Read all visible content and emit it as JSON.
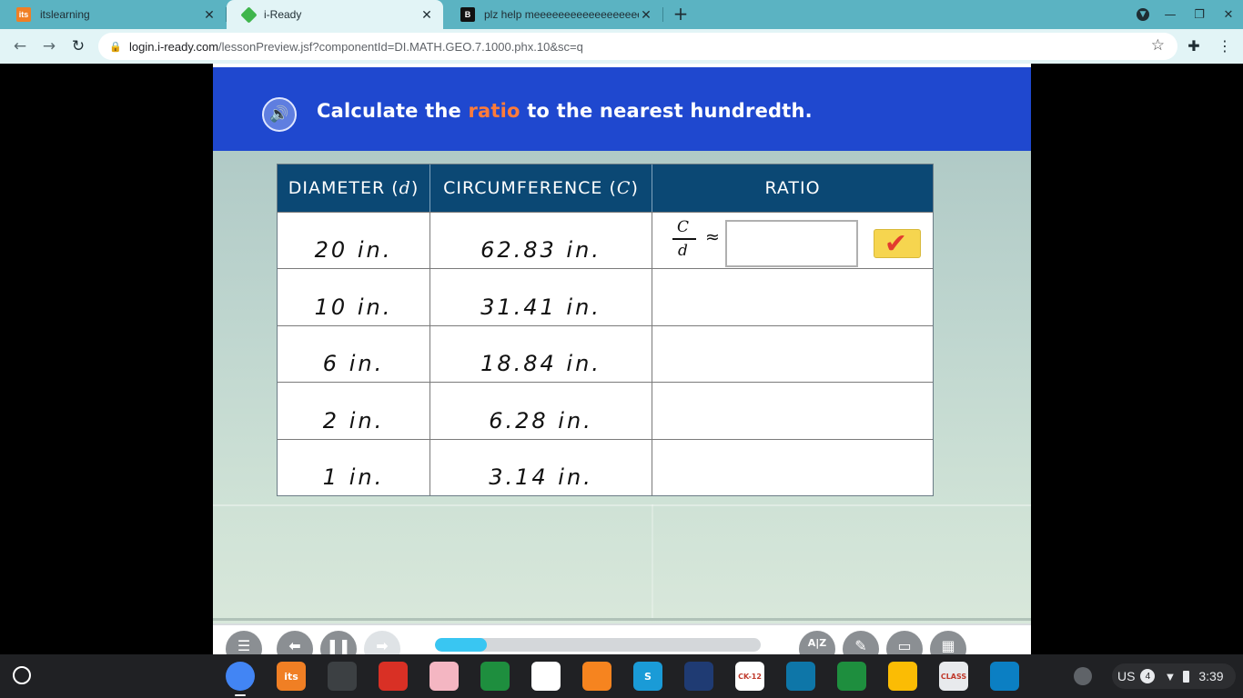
{
  "browser": {
    "tabs": [
      {
        "title": "itslearning",
        "favicon": "its",
        "favicon_color": "#f07f24",
        "active": false
      },
      {
        "title": "i-Ready",
        "favicon": "iready-cube-icon",
        "favicon_color": "#3fb54c",
        "active": true
      },
      {
        "title": "plz help meeeeeeeeeeeeeeeeeeeeeeeee",
        "favicon": "B",
        "favicon_color": "#111111",
        "active": false
      }
    ],
    "new_tab_label": "+",
    "address": {
      "domain": "login.i-ready.com",
      "path": "/lessonPreview.jsf?componentId=DI.MATH.GEO.7.1000.phx.10&sc=q"
    }
  },
  "lesson": {
    "prompt_before": "Calculate the ",
    "prompt_highlight": "ratio",
    "prompt_after": " to the nearest hundredth.",
    "highlight_color": "#ff7b39",
    "header_color": "#1f48cf",
    "table": {
      "headers": {
        "diameter": "DIAMETER (",
        "diameter_var": "d",
        "circumference": "CIRCUMFERENCE (",
        "circumference_var": "C",
        "close": ")",
        "ratio": "RATIO"
      },
      "rows": [
        {
          "diameter": "20 in.",
          "circumference": "62.83 in."
        },
        {
          "diameter": "10 in.",
          "circumference": "31.41 in."
        },
        {
          "diameter": "6 in.",
          "circumference": "18.84 in."
        },
        {
          "diameter": "2 in.",
          "circumference": "6.28 in."
        },
        {
          "diameter": "1 in.",
          "circumference": "3.14 in."
        }
      ],
      "fraction_numerator": "C",
      "fraction_denominator": "d",
      "approx_symbol": "≈",
      "ratio_input_value": "",
      "check_symbol": "✔"
    }
  },
  "controls": {
    "progress_fraction": 0.16,
    "progress_color": "#39c6f2"
  },
  "shelf": {
    "apps": [
      {
        "name": "chrome-icon",
        "color": "#4285f4",
        "label": ""
      },
      {
        "name": "itslearning-app-icon",
        "color": "#f07f24",
        "label": "its"
      },
      {
        "name": "camera-icon",
        "color": "#3c4043",
        "label": ""
      },
      {
        "name": "red-cube-icon",
        "color": "#d93025",
        "label": ""
      },
      {
        "name": "pink-app-icon",
        "color": "#f4b6c2",
        "label": ""
      },
      {
        "name": "desmos-icon",
        "color": "#1e8e3e",
        "label": ""
      },
      {
        "name": "geogebra-icon",
        "color": "#ffffff",
        "label": ""
      },
      {
        "name": "orange-app-icon",
        "color": "#f6841f",
        "label": ""
      },
      {
        "name": "s-app-icon",
        "color": "#1a9bd7",
        "label": "S"
      },
      {
        "name": "butterfly-icon",
        "color": "#1f3b73",
        "label": ""
      },
      {
        "name": "ck12-icon",
        "color": "#ffffff",
        "label": "CK-12"
      },
      {
        "name": "typingclub-icon",
        "color": "#0e76a8",
        "label": ""
      },
      {
        "name": "classroom-icon",
        "color": "#1e8e3e",
        "label": ""
      },
      {
        "name": "drive-icon",
        "color": "#fbbc04",
        "label": ""
      },
      {
        "name": "class-app-icon",
        "color": "#e8eaed",
        "label": "CLASS"
      },
      {
        "name": "education-app-icon",
        "color": "#0b7fc3",
        "label": ""
      }
    ],
    "locale": "US",
    "notification_count": "4",
    "time": "3:39"
  }
}
